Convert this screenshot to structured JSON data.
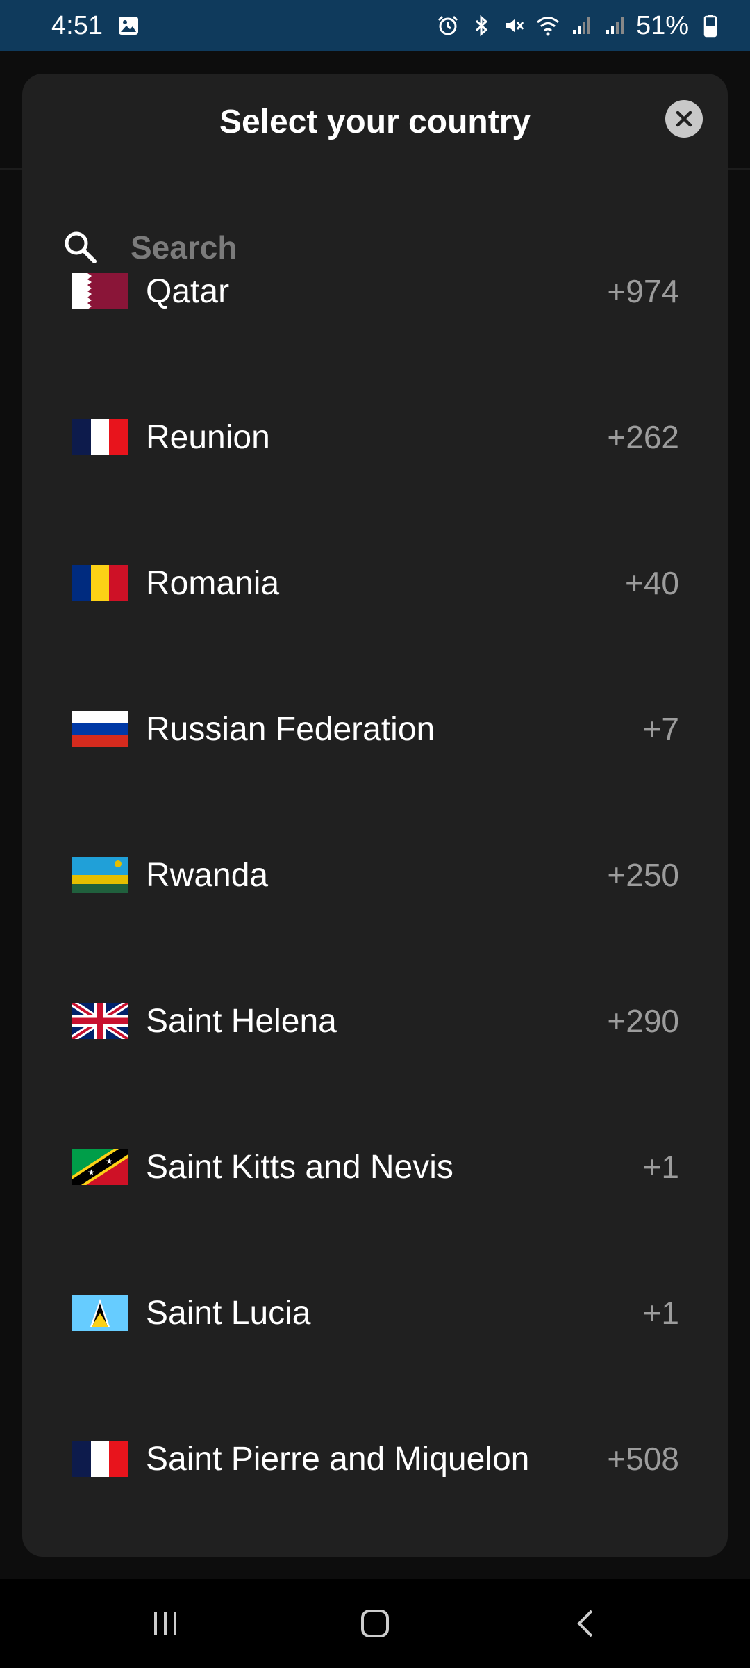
{
  "status_bar": {
    "time": "4:51",
    "battery": "51%",
    "icons": [
      "gallery-icon",
      "alarm-icon",
      "bluetooth-icon",
      "mute-icon",
      "wifi-icon",
      "signal-icon",
      "signal-icon",
      "battery-icon"
    ]
  },
  "dialog": {
    "title": "Select your country",
    "close_icon": "close-icon",
    "search": {
      "placeholder": "Search",
      "value": "",
      "icon": "search-icon"
    }
  },
  "countries": [
    {
      "name": "Qatar",
      "code": "+974",
      "flag": "qatar-flag"
    },
    {
      "name": "Reunion",
      "code": "+262",
      "flag": "reunion-flag"
    },
    {
      "name": "Romania",
      "code": "+40",
      "flag": "romania-flag"
    },
    {
      "name": "Russian Federation",
      "code": "+7",
      "flag": "russia-flag"
    },
    {
      "name": "Rwanda",
      "code": "+250",
      "flag": "rwanda-flag"
    },
    {
      "name": "Saint Helena",
      "code": "+290",
      "flag": "saint-helena-flag"
    },
    {
      "name": "Saint Kitts and Nevis",
      "code": "+1",
      "flag": "saint-kitts-flag"
    },
    {
      "name": "Saint Lucia",
      "code": "+1",
      "flag": "saint-lucia-flag"
    },
    {
      "name": "Saint Pierre and Miquelon",
      "code": "+508",
      "flag": "saint-pierre-flag"
    }
  ],
  "nav_bar": {
    "icons": [
      "recents-icon",
      "home-icon",
      "back-icon"
    ]
  },
  "colors": {
    "status_bar": "#0f3a5c",
    "sheet": "#202020",
    "code_text": "#9c9c9c",
    "placeholder": "#7b7b7b"
  }
}
